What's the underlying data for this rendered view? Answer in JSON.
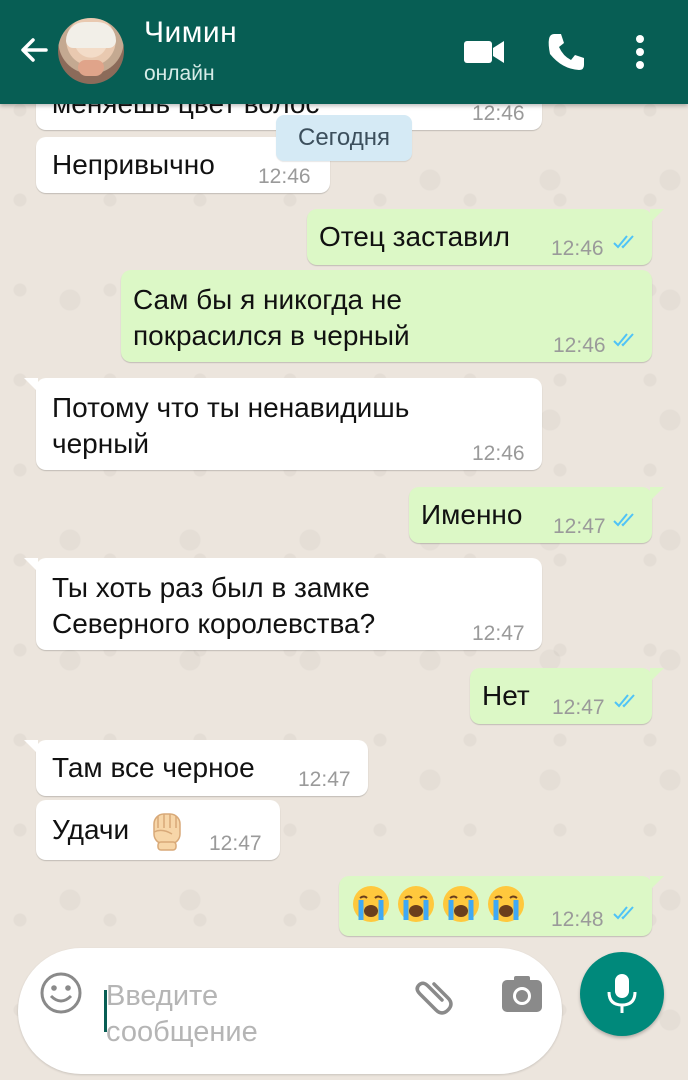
{
  "header": {
    "contact_name": "Чимин",
    "status": "онлайн"
  },
  "date_label": "Сегодня",
  "messages": [
    {
      "dir": "in",
      "text": "меняешь цвет волос",
      "time": "12:46"
    },
    {
      "dir": "in",
      "text": "Непривычно",
      "time": "12:46"
    },
    {
      "dir": "out",
      "text": "Отец заставил",
      "time": "12:46",
      "read": true
    },
    {
      "dir": "out",
      "text": "Сам бы я никогда не\nпокрасился в черный",
      "time": "12:46",
      "read": true
    },
    {
      "dir": "in",
      "text": "Потому что ты ненавидишь\nчерный",
      "time": "12:46"
    },
    {
      "dir": "out",
      "text": "Именно",
      "time": "12:47",
      "read": true
    },
    {
      "dir": "in",
      "text": "Ты хоть раз был в замке\nСеверного королевства?",
      "time": "12:47"
    },
    {
      "dir": "out",
      "text": "Нет",
      "time": "12:47",
      "read": true
    },
    {
      "dir": "in",
      "text": "Там все черное",
      "time": "12:47"
    },
    {
      "dir": "in",
      "text": "Удачи",
      "time": "12:47",
      "emoji": "raised-fist"
    },
    {
      "dir": "out",
      "text": "",
      "time": "12:48",
      "read": true,
      "emoji": "loudly-crying-face x4"
    }
  ],
  "input": {
    "placeholder": "Введите\nсообщение"
  },
  "icons": {
    "back": "arrow-left-icon",
    "video": "video-camera-icon",
    "call": "phone-icon",
    "menu": "more-vertical-icon",
    "emoji": "smiley-icon",
    "attach": "paperclip-icon",
    "camera": "camera-icon",
    "mic": "microphone-icon"
  },
  "colors": {
    "header": "#075e54",
    "outgoing_bubble": "#dcf8c6",
    "incoming_bubble": "#ffffff",
    "read_ticks": "#4fc3f7",
    "mic_button": "#00897b"
  }
}
